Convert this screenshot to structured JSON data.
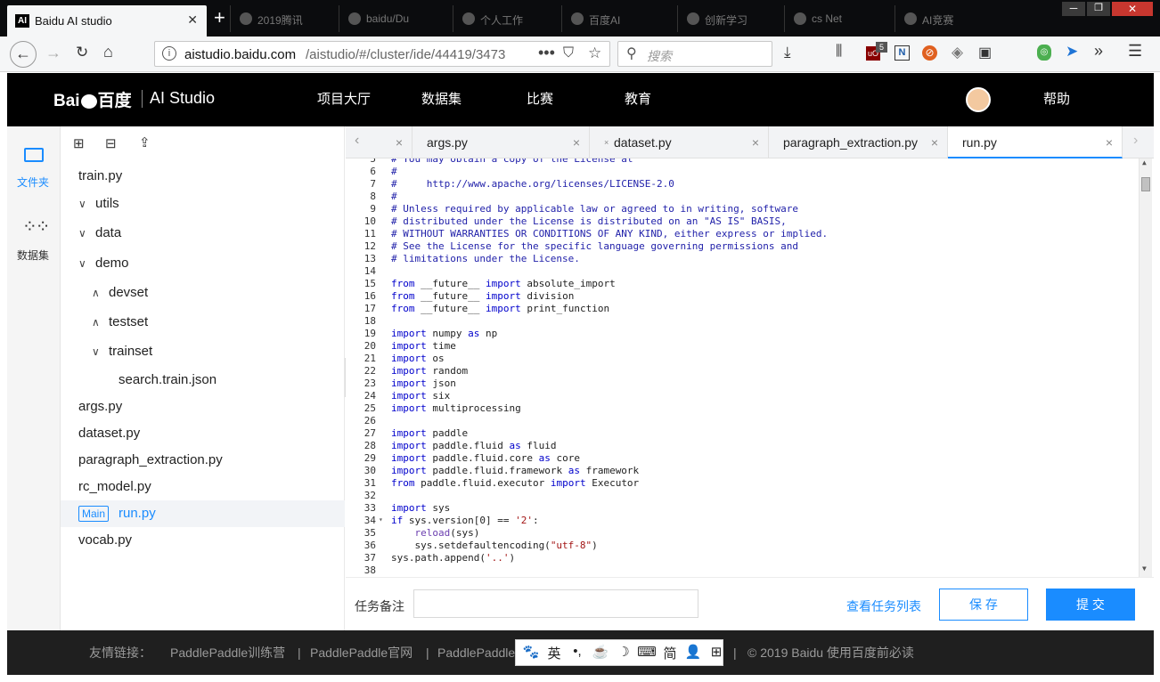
{
  "browser": {
    "active_tab_title": "Baidu AI studio",
    "active_tab_favicon": "AI",
    "inactive_tabs": [
      "2019腾讯",
      "baidu/Du",
      "个人工作",
      "百度AI",
      "创新学习",
      "cs Net",
      "AI竞赛"
    ],
    "new_tab_label": "+",
    "url_host": "aistudio.baidu.com",
    "url_path": "/aistudio/#/cluster/ide/44419/3473",
    "search_placeholder": "搜索",
    "ublock_badge": "5",
    "icons": [
      "back-icon",
      "forward-icon",
      "reload-icon",
      "home-icon",
      "info-icon",
      "more-icon",
      "pocket-icon",
      "star-icon",
      "search-icon",
      "download-icon",
      "library-icon",
      "ublock-icon",
      "extension-n-icon",
      "block-icon",
      "target-icon",
      "screenshot-icon",
      "green-shield-icon",
      "cursor-icon",
      "overflow-icon",
      "menu-icon"
    ]
  },
  "header": {
    "logo_text": "Bai du 百度",
    "product": "AI Studio",
    "nav": [
      "项目大厅",
      "数据集",
      "比赛",
      "教育"
    ],
    "help": "帮助"
  },
  "rail": {
    "items": [
      {
        "label": "文件夹",
        "icon": "folder-icon",
        "active": true
      },
      {
        "label": "数据集",
        "icon": "dataset-icon",
        "active": false
      }
    ]
  },
  "files": {
    "toolbar": [
      "new-file-icon",
      "new-folder-icon",
      "upload-icon"
    ],
    "tree": [
      {
        "name": "train.py",
        "indent": 0,
        "arrow": ""
      },
      {
        "name": "utils",
        "indent": 0,
        "arrow": "∨"
      },
      {
        "name": "data",
        "indent": 0,
        "arrow": "∨"
      },
      {
        "name": "demo",
        "indent": 1,
        "arrow": "∨"
      },
      {
        "name": "devset",
        "indent": 2,
        "arrow": "∧"
      },
      {
        "name": "testset",
        "indent": 2,
        "arrow": "∧"
      },
      {
        "name": "trainset",
        "indent": 2,
        "arrow": "∨"
      },
      {
        "name": "search.train.json",
        "indent": 3,
        "arrow": ""
      },
      {
        "name": "args.py",
        "indent": 0,
        "arrow": ""
      },
      {
        "name": "dataset.py",
        "indent": 0,
        "arrow": ""
      },
      {
        "name": "paragraph_extraction.py",
        "indent": 0,
        "arrow": ""
      },
      {
        "name": "rc_model.py",
        "indent": 0,
        "arrow": ""
      },
      {
        "name": "run.py",
        "indent": 0,
        "arrow": "",
        "badge": "Main",
        "selected": true
      },
      {
        "name": "vocab.py",
        "indent": 0,
        "arrow": ""
      }
    ]
  },
  "editor": {
    "tabs": [
      {
        "name": "",
        "close": "×"
      },
      {
        "name": "args.py",
        "close": "×"
      },
      {
        "name": "dataset.py",
        "close": "×",
        "modified": "×"
      },
      {
        "name": "paragraph_extraction.py",
        "close": "×"
      },
      {
        "name": "run.py",
        "close": "×",
        "active": true
      }
    ],
    "lines": [
      {
        "n": "5",
        "t": "# You may obtain a copy of the License at",
        "c": "cm"
      },
      {
        "n": "6",
        "t": "#",
        "c": "cm"
      },
      {
        "n": "7",
        "t": "#     http://www.apache.org/licenses/LICENSE-2.0",
        "c": "cm"
      },
      {
        "n": "8",
        "t": "#",
        "c": "cm"
      },
      {
        "n": "9",
        "t": "# Unless required by applicable law or agreed to in writing, software",
        "c": "cm"
      },
      {
        "n": "10",
        "t": "# distributed under the License is distributed on an \"AS IS\" BASIS,",
        "c": "cm"
      },
      {
        "n": "11",
        "t": "# WITHOUT WARRANTIES OR CONDITIONS OF ANY KIND, either express or implied.",
        "c": "cm"
      },
      {
        "n": "12",
        "t": "# See the License for the specific language governing permissions and",
        "c": "cm"
      },
      {
        "n": "13",
        "t": "# limitations under the License.",
        "c": "cm"
      },
      {
        "n": "14",
        "t": "",
        "c": ""
      },
      {
        "n": "15",
        "t": "from __future__ import absolute_import",
        "c": "py"
      },
      {
        "n": "16",
        "t": "from __future__ import division",
        "c": "py"
      },
      {
        "n": "17",
        "t": "from __future__ import print_function",
        "c": "py"
      },
      {
        "n": "18",
        "t": "",
        "c": ""
      },
      {
        "n": "19",
        "t": "import numpy as np",
        "c": "py"
      },
      {
        "n": "20",
        "t": "import time",
        "c": "py"
      },
      {
        "n": "21",
        "t": "import os",
        "c": "py"
      },
      {
        "n": "22",
        "t": "import random",
        "c": "py"
      },
      {
        "n": "23",
        "t": "import json",
        "c": "py"
      },
      {
        "n": "24",
        "t": "import six",
        "c": "py"
      },
      {
        "n": "25",
        "t": "import multiprocessing",
        "c": "py"
      },
      {
        "n": "26",
        "t": "",
        "c": ""
      },
      {
        "n": "27",
        "t": "import paddle",
        "c": "py"
      },
      {
        "n": "28",
        "t": "import paddle.fluid as fluid",
        "c": "py"
      },
      {
        "n": "29",
        "t": "import paddle.fluid.core as core",
        "c": "py"
      },
      {
        "n": "30",
        "t": "import paddle.fluid.framework as framework",
        "c": "py"
      },
      {
        "n": "31",
        "t": "from paddle.fluid.executor import Executor",
        "c": "py"
      },
      {
        "n": "32",
        "t": "",
        "c": ""
      },
      {
        "n": "33",
        "t": "import sys",
        "c": "py"
      },
      {
        "n": "34",
        "t": "if sys.version[0] == '2':",
        "c": "py",
        "fold": "▾"
      },
      {
        "n": "35",
        "t": "    reload(sys)",
        "c": "py"
      },
      {
        "n": "36",
        "t": "    sys.setdefaultencoding(\"utf-8\")",
        "c": "py"
      },
      {
        "n": "37",
        "t": "sys.path.append('..')",
        "c": "py"
      },
      {
        "n": "38",
        "t": "",
        "c": ""
      }
    ]
  },
  "bottom": {
    "note_label": "任务备注",
    "note_value": "",
    "view_tasks": "查看任务列表",
    "save": "保 存",
    "submit": "提 交"
  },
  "footer": {
    "links_label": "友情链接：",
    "links": [
      "PaddlePaddle训练营",
      "PaddlePaddle官网",
      "PaddlePaddle"
    ],
    "separator": "|",
    "copyright": "© 2019 Baidu 使用百度前必读"
  },
  "ime": {
    "items": [
      "🐾",
      "英",
      "•,",
      "☕",
      "☽",
      "⌨",
      "简",
      "👤",
      "⊞"
    ]
  },
  "colors": {
    "accent": "#1a8cff",
    "header_bg": "#000000",
    "footer_bg": "#1f1f1f",
    "keyword": "#0000cc",
    "comment": "#2222aa",
    "string": "#a31515"
  }
}
